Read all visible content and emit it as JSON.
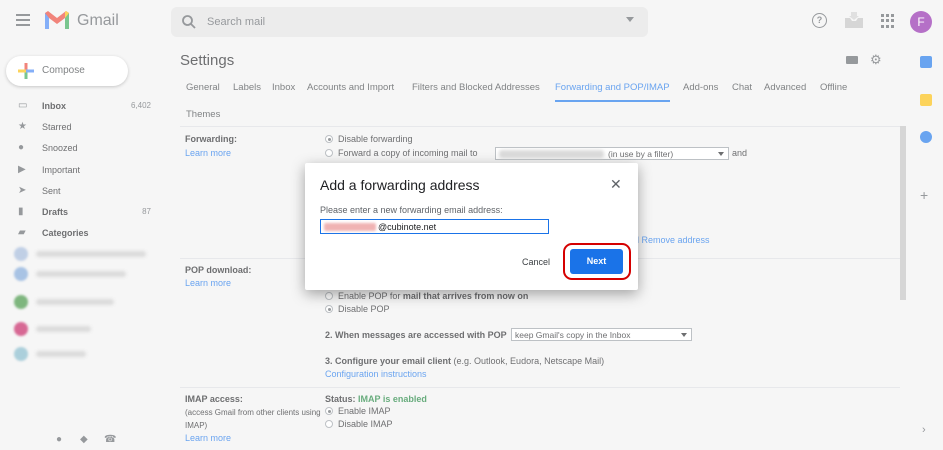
{
  "header": {
    "app_name": "Gmail",
    "search_placeholder": "Search mail",
    "help_glyph": "?",
    "avatar_letter": "F",
    "avatar_color": "#8e24aa"
  },
  "sidebar": {
    "compose_label": "Compose",
    "items": [
      {
        "label": "Inbox",
        "count": "6,402",
        "icon": "inbox-icon",
        "bold": true
      },
      {
        "label": "Starred",
        "count": "",
        "icon": "star-icon",
        "bold": false
      },
      {
        "label": "Snoozed",
        "count": "",
        "icon": "clock-icon",
        "bold": false
      },
      {
        "label": "Important",
        "count": "",
        "icon": "important-icon",
        "bold": false
      },
      {
        "label": "Sent",
        "count": "",
        "icon": "send-icon",
        "bold": false
      },
      {
        "label": "Drafts",
        "count": "87",
        "icon": "draft-icon",
        "bold": true
      },
      {
        "label": "Categories",
        "count": "",
        "icon": "label-icon",
        "bold": true
      }
    ]
  },
  "main": {
    "title": "Settings",
    "tabs": [
      {
        "label": "General"
      },
      {
        "label": "Labels"
      },
      {
        "label": "Inbox"
      },
      {
        "label": "Accounts and Import"
      },
      {
        "label": "Filters and Blocked Addresses"
      },
      {
        "label": "Forwarding and POP/IMAP",
        "active": true
      },
      {
        "label": "Add-ons"
      },
      {
        "label": "Chat"
      },
      {
        "label": "Advanced"
      },
      {
        "label": "Offline"
      },
      {
        "label": "Themes"
      }
    ],
    "forwarding": {
      "label": "Forwarding:",
      "learn_more": "Learn more",
      "opt_disable": "Disable forwarding",
      "opt_forward": "Forward a copy of incoming mail to",
      "select_suffix": "(in use by a filter)",
      "and": "and",
      "remove_address": "l Remove address"
    },
    "pop": {
      "label": "POP download:",
      "learn_more": "Learn more",
      "opt_enable_prefix": "Enable POP for ",
      "opt_enable_bold": "mail that arrives from now on",
      "opt_disable": "Disable POP",
      "q2": "2. When messages are accessed with POP",
      "q2_select": "keep Gmail's copy in the Inbox",
      "q3": "3. Configure your email client",
      "q3_suffix": " (e.g. Outlook, Eudora, Netscape Mail)",
      "config_link": "Configuration instructions"
    },
    "imap": {
      "label": "IMAP access:",
      "note": "(access Gmail from other clients using IMAP)",
      "learn_more": "Learn more",
      "status_prefix": "Status: ",
      "status_value": "IMAP is enabled",
      "opt_enable": "Enable IMAP",
      "opt_disable": "Disable IMAP"
    }
  },
  "dialog": {
    "title": "Add a forwarding address",
    "close_glyph": "✕",
    "prompt": "Please enter a new forwarding email address:",
    "input_value": "@cubinote.net",
    "cancel_label": "Cancel",
    "next_label": "Next",
    "highlight_color": "#d50000"
  }
}
